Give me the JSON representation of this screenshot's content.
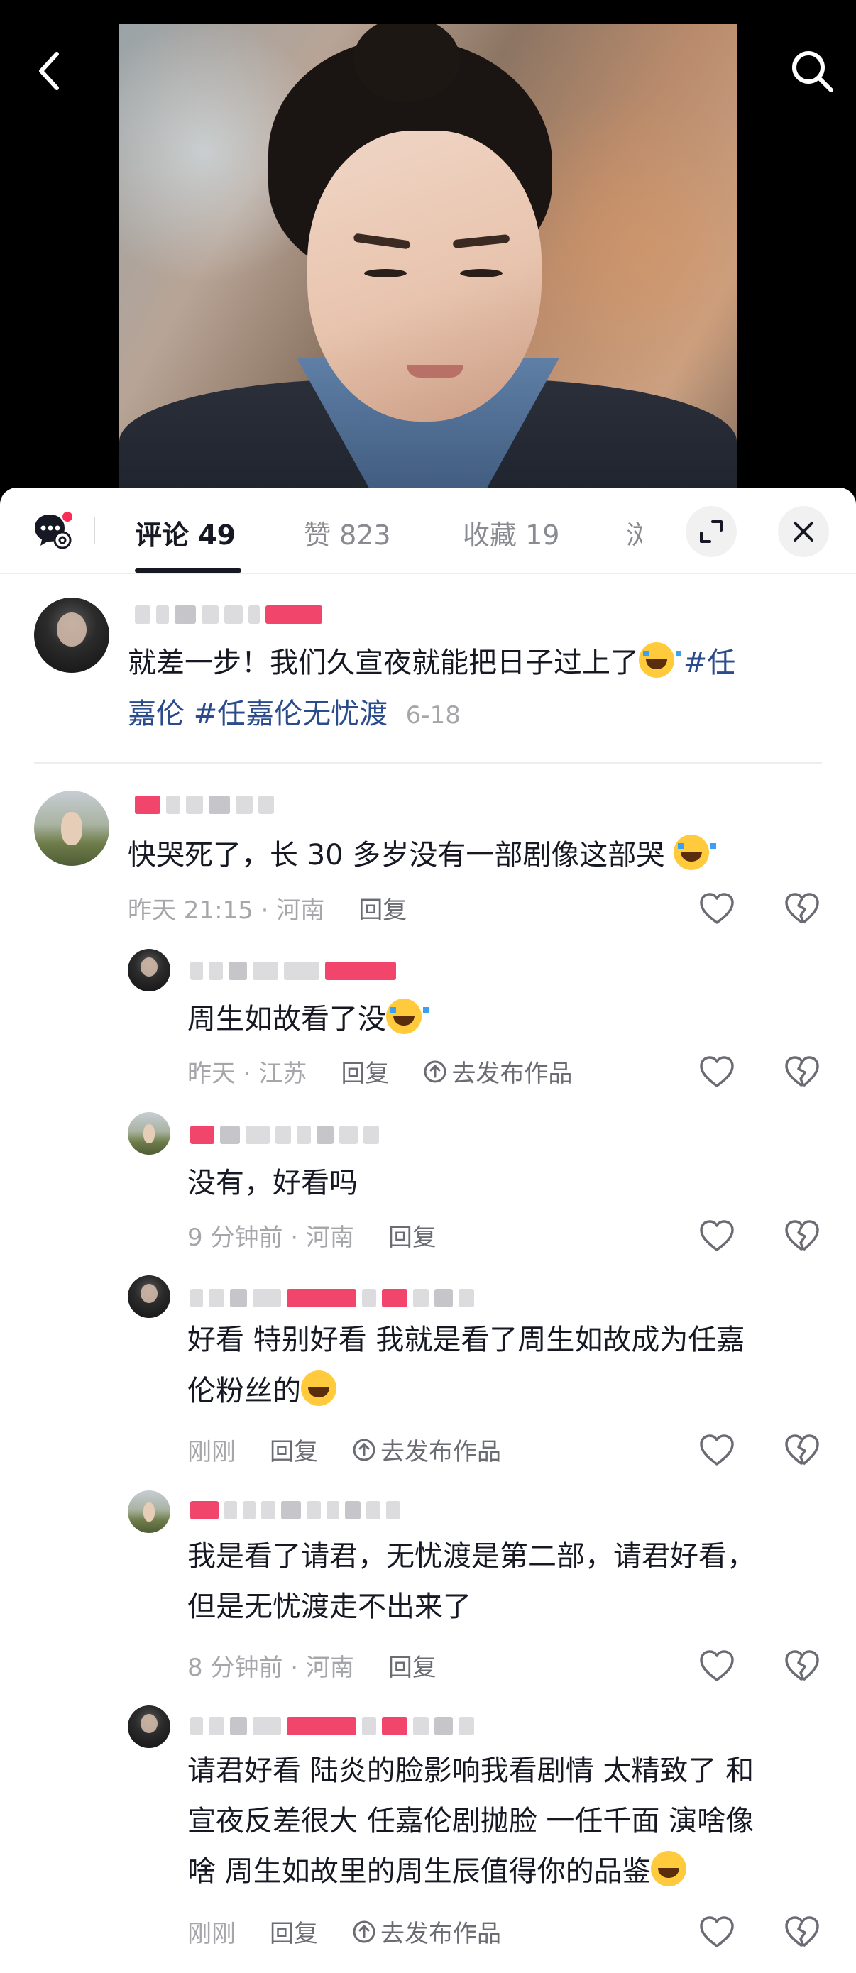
{
  "tabs": {
    "comments": "评论 49",
    "likes": "赞 823",
    "favorites": "收藏 19",
    "more": "浏"
  },
  "post": {
    "text_prefix": "就差一步！我们久宣夜就能把日子过上了",
    "hashtag1_line1": "#任",
    "hashtag1_line2": "嘉伦",
    "hashtag2": "#任嘉伦无忧渡",
    "date": "6-18"
  },
  "comment": {
    "text": "快哭死了，长 30 多岁没有一部剧像这部哭",
    "time": "昨天 21:15 · 河南",
    "reply_label": "回复"
  },
  "replies": [
    {
      "lines": [
        "周生如故看了没"
      ],
      "time": "昨天 · 江苏",
      "reply_label": "回复",
      "publish_label": "去发布作品"
    },
    {
      "lines": [
        "没有，好看吗"
      ],
      "time": "9 分钟前 · 河南",
      "reply_label": "回复"
    },
    {
      "lines": [
        "好看  特别好看 我就是看了周生如故成为任嘉",
        "伦粉丝的"
      ],
      "time": "刚刚",
      "reply_label": "回复",
      "publish_label": "去发布作品"
    },
    {
      "lines": [
        "我是看了请君，无忧渡是第二部，请君好看，",
        "但是无忧渡走不出来了"
      ],
      "time": "8 分钟前 · 河南",
      "reply_label": "回复"
    },
    {
      "lines": [
        "请君好看 陆炎的脸影响我看剧情  太精致了 和",
        "宣夜反差很大 任嘉伦剧抛脸  一任千面 演啥像",
        "啥 周生如故里的周生辰值得你的品鉴"
      ],
      "time": "刚刚",
      "reply_label": "回复",
      "publish_label": "去发布作品"
    }
  ],
  "colors": {
    "accent": "#fe2c55",
    "hashtag": "#2b4c8c",
    "meta": "#a5a6aa"
  },
  "icons": [
    "back-icon",
    "search-icon",
    "chat-settings-icon",
    "expand-icon",
    "close-icon",
    "heart-icon",
    "broken-heart-icon",
    "upload-icon",
    "emoji-icon"
  ]
}
